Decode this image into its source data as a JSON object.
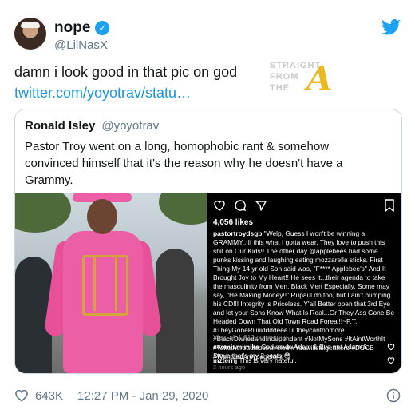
{
  "author": {
    "name": "nope",
    "handle": "@LilNasX"
  },
  "tweet": {
    "text": "damn i look good in that pic on god",
    "link": "twitter.com/yoyotrav/statu…"
  },
  "watermark": {
    "line1": "STRAIGHT",
    "line2": "FROM",
    "line3": "THE",
    "letter": "A"
  },
  "quoted": {
    "name": "Ronald Isley",
    "handle": "@yoyotrav",
    "text": "Pastor Troy went on a long, homophobic rant & somehow convinced himself that it's the reason why he doesn't have a Grammy."
  },
  "instagram": {
    "likes": "4,056 likes",
    "caption_user": "pastortroydsgb",
    "caption": "\"Welp, Guess I won't be winning a GRAMMY...If this what I gotta wear. They love to push this shit on Our Kids!! The other day @applebees had some punks kissing and laughing eating mozzarella sticks. First Thing My 14 yr old Son said was, \"F**** Applebee's\" And It Brought Joy to My Heart!! He sees it...their agenda to take the masculinity from Men, Black Men Especially. Some may say, \"He Making Money!!\" Rupaul do too, but I ain't bumping his CD!!! Integrity is Priceless. Y'all Better open that 3rd Eye and let your Sons Know What Is Real...Or They Ass Gone Be Headed Down That Old Town Road Foreal!!~P.T. #TheyGoneRiiiiiiddddeeeTil theycantnomore #BlackOwnedandIndependent #NotMySons #ItAintWorthIt #Taketheroadlesstraveled #Youwillstillgetthere #DSGB #Wontbeonmypagelong",
    "view_all": "View all 1,612 comments",
    "comments": [
      {
        "user": "ceomiamimike",
        "text": "God made Adam & Eve not Adam & Steve that's my 2 cents 😳"
      },
      {
        "user": "mzterrij",
        "text": "This is very hateful."
      }
    ],
    "time": "3 hours ago"
  },
  "footer": {
    "likes": "643K",
    "timestamp": "12:27 PM - Jan 29, 2020"
  },
  "colors": {
    "link": "#1b95e0",
    "twitter_blue": "#1da1f2",
    "secondary": "#657786"
  }
}
